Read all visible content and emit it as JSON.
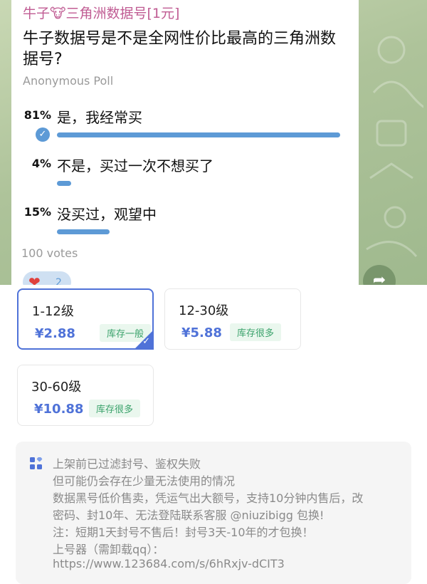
{
  "chat": {
    "sender": "牛子🐮三角洲数据号[1元]",
    "question": "牛子数据号是不是全网性价比最高的三角洲数据号?",
    "poll_type": "Anonymous Poll",
    "options": [
      {
        "percent": "81%",
        "text": "是，我经常买",
        "fraction": 0.81,
        "chosen": true
      },
      {
        "percent": "4%",
        "text": "不是，买过一次不想买了",
        "fraction": 0.04,
        "chosen": false
      },
      {
        "percent": "15%",
        "text": "没买过，观望中",
        "fraction": 0.15,
        "chosen": false
      }
    ],
    "votes": "100 votes",
    "reaction": {
      "icon": "heart-icon",
      "count": "2"
    },
    "accent": "#5d9ad6"
  },
  "options": [
    {
      "level": "1-12级",
      "price": "¥2.88",
      "stock": "库存一般",
      "selected": true
    },
    {
      "level": "12-30级",
      "price": "¥5.88",
      "stock": "库存很多",
      "selected": false
    },
    {
      "level": "30-60级",
      "price": "¥10.88",
      "stock": "库存很多",
      "selected": false
    }
  ],
  "notice": {
    "icon": "grid-icon",
    "lines": [
      "上架前已过滤封号、鉴权失败",
      "但可能仍会存在少量无法使用的情况",
      "数据黑号低价售卖，凭运气出大额号，支持10分钟内售后，改",
      "密码、封10年、无法登陆联系客服 @niuzibigg 包换!",
      "注：短期1天封号不售后！封号3天-10年的才包换！",
      "上号器（需卸载qq）：",
      "https://www.123684.com/s/6hRxjv-dCIT3"
    ]
  },
  "colors": {
    "brand": "#4f72d8",
    "stock_green": "#3aa26b",
    "sender": "#c05c93"
  }
}
